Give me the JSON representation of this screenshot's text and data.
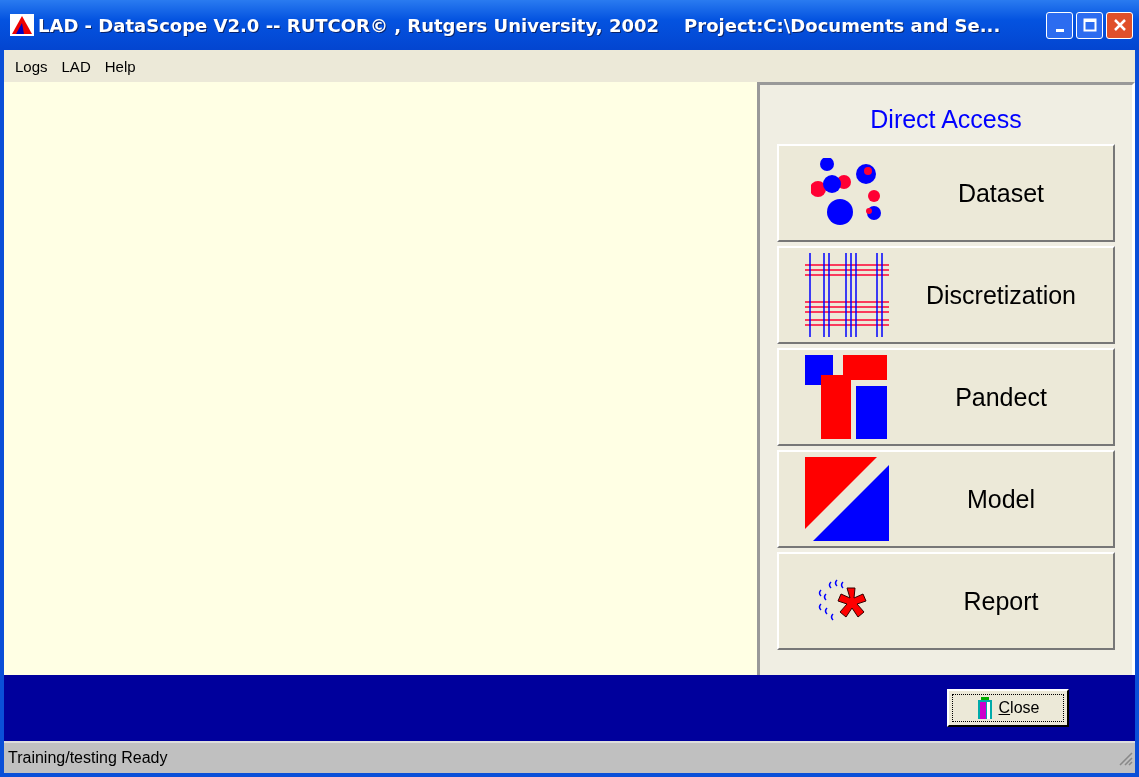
{
  "window": {
    "title": "LAD - DataScope V2.0 -- RUTCOR© , Rutgers University, 2002    Project:C:\\Documents and Se..."
  },
  "menu": [
    "Logs",
    "LAD",
    "Help"
  ],
  "panel": {
    "title": "Direct Access",
    "buttons": [
      {
        "kind": "dataset",
        "label": "Dataset"
      },
      {
        "kind": "discretization",
        "label": "Discretization"
      },
      {
        "kind": "pandect",
        "label": "Pandect"
      },
      {
        "kind": "model",
        "label": "Model"
      },
      {
        "kind": "report",
        "label": "Report"
      }
    ]
  },
  "close_button": "Close",
  "status_bar": "Training/testing Ready"
}
